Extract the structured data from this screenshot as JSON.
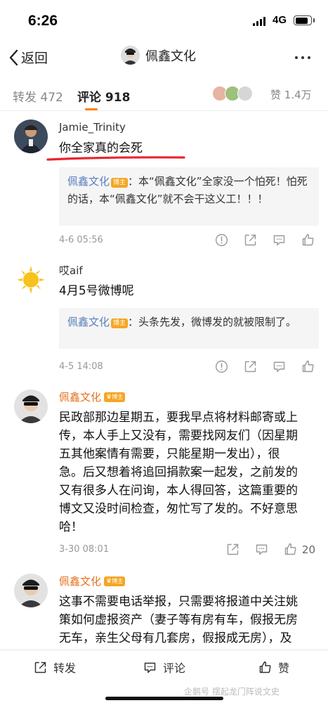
{
  "status": {
    "time": "6:26",
    "network": "4G"
  },
  "nav": {
    "back_label": "返回",
    "title": "佩鑫文化"
  },
  "tabs": {
    "repost_label": "转发",
    "repost_count": "472",
    "comment_label": "评论",
    "comment_count": "918",
    "likes_label": "赞",
    "likes_count": "1.4万"
  },
  "comments": [
    {
      "author": "Jamie_Trinity",
      "text": "你全家真的会死",
      "reply": {
        "name": "佩鑫文化",
        "badge": "博主",
        "text": "：本“佩鑫文化”全家没一个怕死！怕死的话，本“佩鑫文化”就不会干这义工！！！"
      },
      "time": "4-6 05:56"
    },
    {
      "author": "哎aif",
      "text": "4月5号微博呢",
      "reply": {
        "name": "佩鑫文化",
        "badge": "博主",
        "text": "：头条先发，微博发的就被限制了。"
      },
      "time": "4-5 14:08"
    },
    {
      "author": "佩鑫文化",
      "badge": "博主",
      "text_lines": [
        "民政部那边星期五，要我早点将材料邮寄或上",
        "传，本人手上又没有，需要找网友们（因星期",
        "五其他案情有需要，只能星期一发出），很",
        "急。后又想着将追回捐款案一起发，之前发的",
        "又有很多人在问询，本人得回答，这篇重要的",
        "博文又没时间检查，匆忙写了发的。不好意思",
        "哈！"
      ],
      "time": "3-30 08:01",
      "likes": "20"
    },
    {
      "author": "佩鑫文化",
      "badge": "博主",
      "text_lines": [
        "这事不需要电话举报，只需要将报道中关注姚",
        "策如何虚报资产（妻子等有房有车，假报无房",
        "无车，亲生父母有几套房，假报成无房），及"
      ]
    }
  ],
  "bottom": {
    "repost": "转发",
    "comment": "评论",
    "like": "赞",
    "watermark": "企鹅号 摆起龙门阵说文史"
  },
  "colors": {
    "accent": "#ff8200",
    "blogger_name": "#e5731f",
    "reply_name": "#5b7fbd",
    "underline_mark": "#e8262e"
  }
}
